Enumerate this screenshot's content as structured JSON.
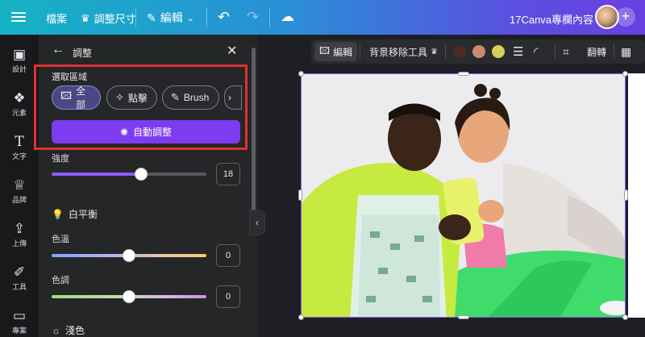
{
  "topbar": {
    "file": "檔案",
    "resize": "調整尺寸",
    "edit": "編輯",
    "project": "17Canva專欄內容"
  },
  "rail": {
    "items": [
      {
        "label": "設計",
        "icon": "layout-icon"
      },
      {
        "label": "元素",
        "icon": "shapes-icon"
      },
      {
        "label": "文字",
        "icon": "text-icon"
      },
      {
        "label": "品牌",
        "icon": "brand-icon"
      },
      {
        "label": "上傳",
        "icon": "upload-cloud-icon"
      },
      {
        "label": "工具",
        "icon": "draw-tool-icon"
      },
      {
        "label": "專案",
        "icon": "folder-icon"
      }
    ]
  },
  "panel": {
    "title": "調整",
    "selection_label": "選取區域",
    "chips": [
      {
        "label": "全部",
        "active": true
      },
      {
        "label": "點擊",
        "active": false
      },
      {
        "label": "Brush",
        "active": false
      }
    ],
    "auto_adjust": "自動調整",
    "intensity": {
      "label": "強度",
      "value": "18",
      "position": 0.58
    },
    "white_balance": {
      "title": "白平衡",
      "temperature": {
        "label": "色溫",
        "value": "0",
        "position": 0.5
      },
      "tint": {
        "label": "色調",
        "value": "0",
        "position": 0.5
      }
    },
    "light_title": "淺色"
  },
  "context_toolbar": {
    "edit": "編輯",
    "bg_remover": "背景移除工具",
    "flip": "翻轉",
    "swatches": [
      "#4a2a22",
      "#c98b6f",
      "#d8cf5a"
    ]
  },
  "colors": {
    "accent": "#7d3cf0",
    "highlight": "#e03131"
  }
}
